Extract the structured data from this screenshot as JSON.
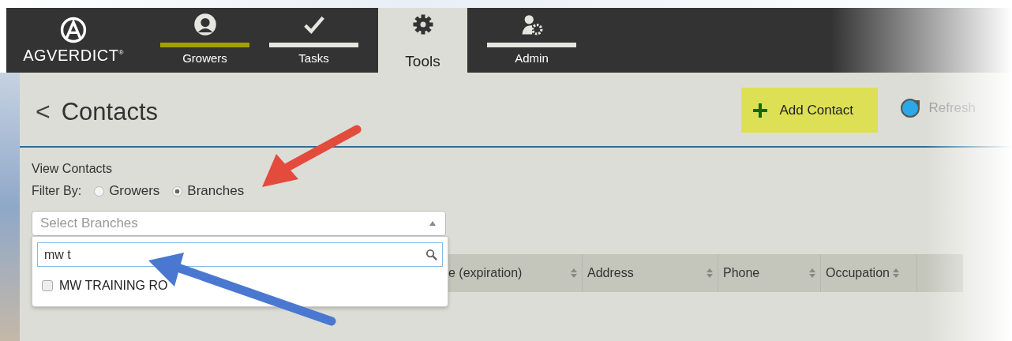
{
  "brand": {
    "name": "AGVERDICT",
    "mark": "®"
  },
  "nav": [
    {
      "label": "Growers",
      "selected": false,
      "highlighted": true
    },
    {
      "label": "Tasks",
      "selected": false,
      "highlighted": false
    },
    {
      "label": "Tools",
      "selected": true,
      "highlighted": false
    },
    {
      "label": "Admin",
      "selected": false,
      "highlighted": false
    }
  ],
  "page": {
    "back": "<",
    "title": "Contacts"
  },
  "actions": [
    {
      "kind": "add",
      "label": "Add Contact"
    },
    {
      "kind": "refresh",
      "label": "Refresh",
      "disabled": true
    }
  ],
  "view": {
    "heading": "View Contacts",
    "filter_label": "Filter By:",
    "options": [
      {
        "label": "Growers",
        "selected": false
      },
      {
        "label": "Branches",
        "selected": true
      }
    ]
  },
  "select": {
    "placeholder": "Select Branches",
    "expanded": true,
    "search": "mw t",
    "items": [
      {
        "label": "MW TRAINING RO",
        "checked": false
      }
    ]
  },
  "table": {
    "columns": [
      "e (expiration)",
      "Address",
      "Phone",
      "Occupation"
    ]
  }
}
